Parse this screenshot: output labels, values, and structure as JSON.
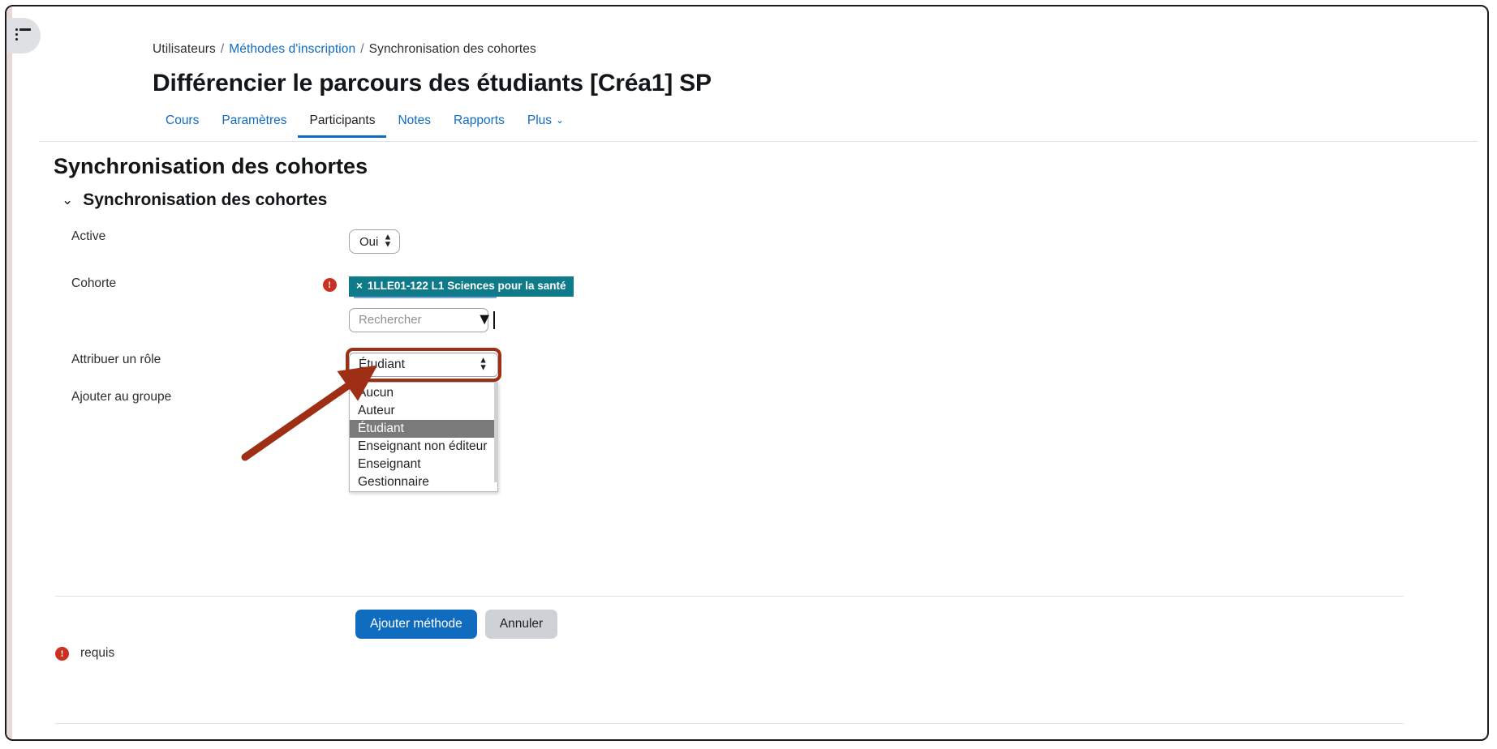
{
  "window": {
    "drawer_toggle_icon": "list-menu-icon"
  },
  "breadcrumb": {
    "item1": "Utilisateurs",
    "item2": "Méthodes d'inscription",
    "item3": "Synchronisation des cohortes",
    "separator": "/"
  },
  "header": {
    "page_title": "Différencier le parcours des étudiants [Créa1] SP"
  },
  "tabs": [
    {
      "label": "Cours",
      "active": false
    },
    {
      "label": "Paramètres",
      "active": false
    },
    {
      "label": "Participants",
      "active": true
    },
    {
      "label": "Notes",
      "active": false
    },
    {
      "label": "Rapports",
      "active": false
    },
    {
      "label": "Plus",
      "active": false,
      "chevron": "⌄"
    }
  ],
  "main": {
    "section_title": "Synchronisation des cohortes",
    "collapse_caret": "⌄",
    "collapse_title": "Synchronisation des cohortes"
  },
  "form": {
    "required_marker": "!",
    "rows": {
      "active": {
        "label": "Active",
        "value": "Oui"
      },
      "cohorte": {
        "label": "Cohorte",
        "tag_remove": "×",
        "tag_text": "1LLE01-122 L1 Sciences pour la santé",
        "search_placeholder": "Rechercher",
        "search_value": "",
        "dropdown_arrow": "▼"
      },
      "role": {
        "label": "Attribuer un rôle",
        "value": "Étudiant",
        "options": [
          "Aucun",
          "Auteur",
          "Étudiant",
          "Enseignant non éditeur",
          "Enseignant",
          "Gestionnaire"
        ],
        "selected_option": "Étudiant"
      },
      "group": {
        "label": "Ajouter au groupe",
        "value": ""
      }
    }
  },
  "actions": {
    "submit_label": "Ajouter méthode",
    "cancel_label": "Annuler"
  },
  "footer": {
    "required_label": "requis",
    "required_marker": "!"
  },
  "colors": {
    "brand_blue": "#0f6cbf",
    "tag_teal": "#0f7b8a",
    "required_red": "#ca3120",
    "annotation_red": "#9e2f14",
    "option_highlight": "#7a7a7a"
  }
}
